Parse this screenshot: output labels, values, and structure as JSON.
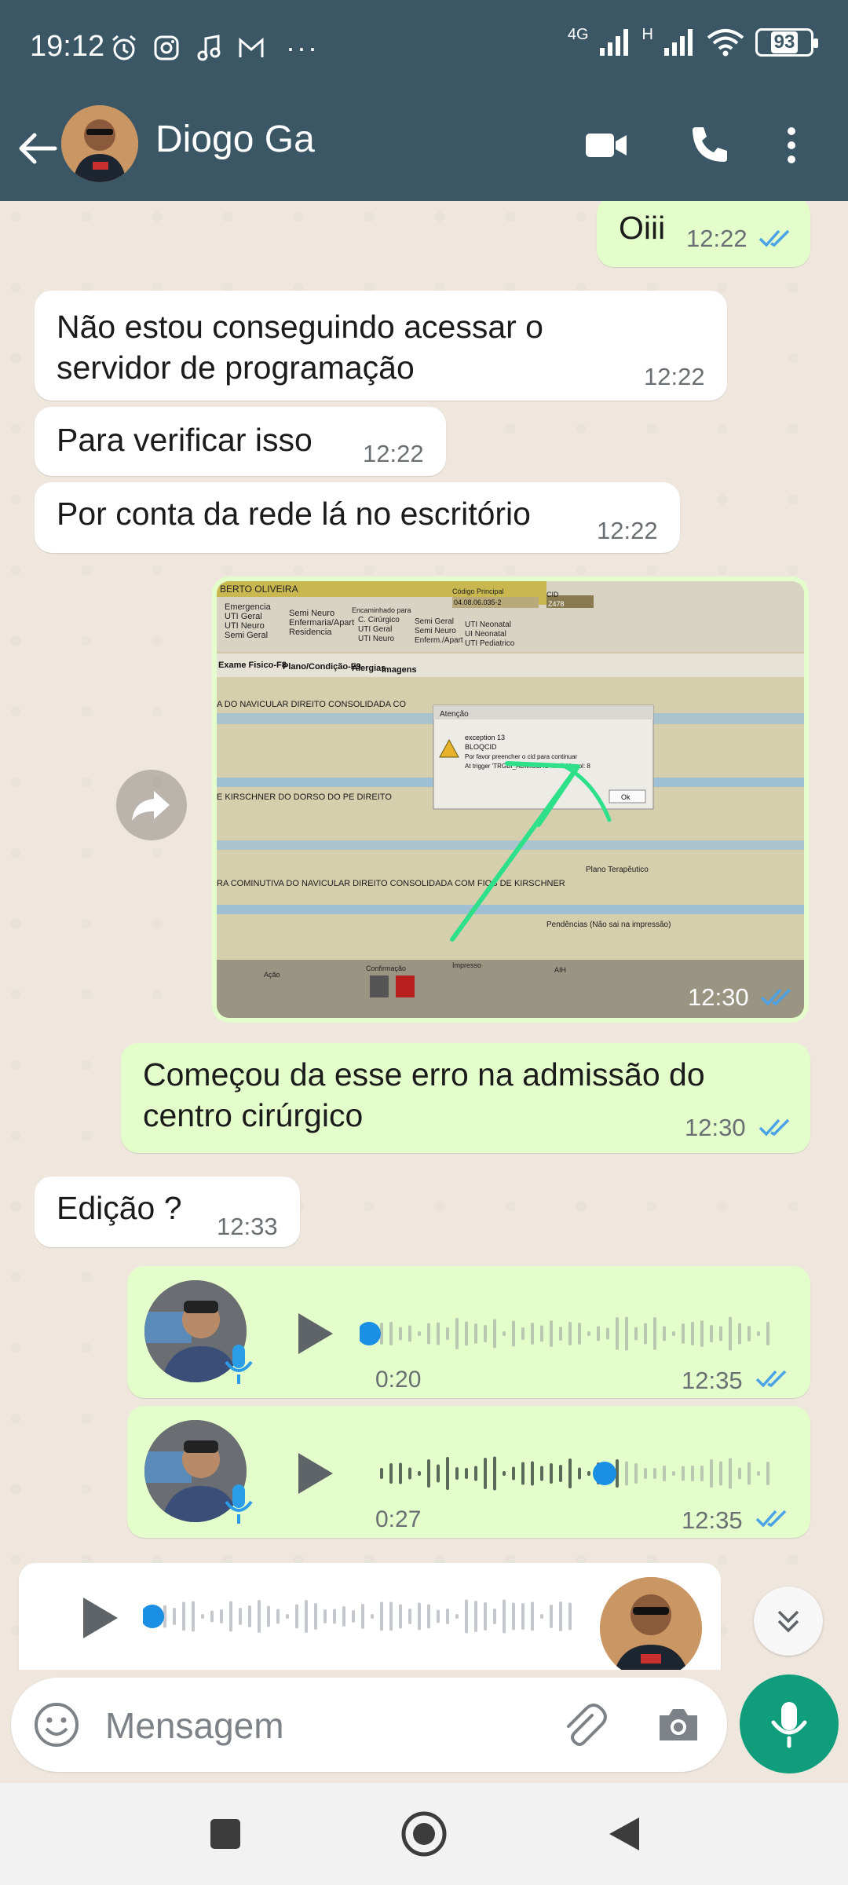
{
  "status": {
    "time": "19:12",
    "net_label_1": "4G",
    "net_label_2": "H",
    "battery": "93",
    "more_icons": "···"
  },
  "header": {
    "contact_name": "Diogo Ga"
  },
  "messages": [
    {
      "direction": "out",
      "text": "Oiii",
      "time": "12:22"
    },
    {
      "direction": "in",
      "text": "Não estou conseguindo acessar o servidor de programação",
      "time": "12:22"
    },
    {
      "direction": "in",
      "text": "Para verificar isso",
      "time": "12:22"
    },
    {
      "direction": "in",
      "text": "Por conta da rede lá no escritório",
      "time": "12:22"
    },
    {
      "direction": "out",
      "type": "image",
      "time": "12:30"
    },
    {
      "direction": "out",
      "text": "Começou da esse erro na admissão do centro cirúrgico",
      "time": "12:30"
    },
    {
      "direction": "in",
      "text": "Edição ?",
      "time": "12:33"
    },
    {
      "direction": "out",
      "type": "voice",
      "duration": "0:20",
      "time": "12:35",
      "progress": 0.0
    },
    {
      "direction": "out",
      "type": "voice",
      "duration": "0:27",
      "time": "12:35",
      "progress": 0.6
    },
    {
      "direction": "in",
      "type": "voice",
      "progress": 0.0
    }
  ],
  "photo": {
    "header_name": "BERTO OLIVEIRA",
    "codigo_label": "Código Principal",
    "codigo_value": "04.08.06.035-2",
    "cid_label": "CID",
    "cid_value": "Z478",
    "radios_col1": [
      "Emergencia",
      "UTI Geral",
      "UTI Neuro",
      "Semi Geral"
    ],
    "radios_col2": [
      "Semi Neuro",
      "Enfermaria/Apart",
      "Residencia"
    ],
    "encaminhado_label": "Encaminhado para",
    "radios_col3": [
      "C. Cirúrgico",
      "UTI Geral",
      "UTI Neuro"
    ],
    "radios_col4": [
      "Semi Geral",
      "Semi Neuro",
      "Enferm./Apart"
    ],
    "radios_col5": [
      "UTI Neonatal",
      "UI Neonatal",
      "UTI Pediatrico"
    ],
    "tabs": [
      "Exame Fisico-F8",
      "Plano/Condição-F9",
      "Alergias",
      "Imagens"
    ],
    "row1": "A DO NAVICULAR DIREITO CONSOLIDADA CO",
    "row2": "E KIRSCHNER DO DORSO DO PE DIREITO",
    "row3": "RA COMINUTIVA DO NAVICULAR DIREITO CONSOLIDADA COM FIOS DE KIRSCHNER",
    "plano": "Plano Terapêutico",
    "pendencias": "Pendências (Não sai na impressão)",
    "dialog_title": "Atenção",
    "dialog_line1": "exception 13",
    "dialog_line2": "BLOQCID",
    "dialog_line3": "Por favor preencher o cid para continuar",
    "dialog_line4": "At trigger 'TRGBI_ADMISSAO' line: 11, col: 8",
    "dialog_ok": "Ok",
    "footer_labels": [
      "Ação",
      "Confirmação",
      "Impresso",
      "AIH"
    ]
  },
  "composer": {
    "placeholder": "Mensagem"
  },
  "colors": {
    "header": "#3b5766",
    "outgoing": "#e3fdcb",
    "incoming": "#ffffff",
    "accent": "#0f9d7c",
    "tick": "#4aa3e6"
  }
}
